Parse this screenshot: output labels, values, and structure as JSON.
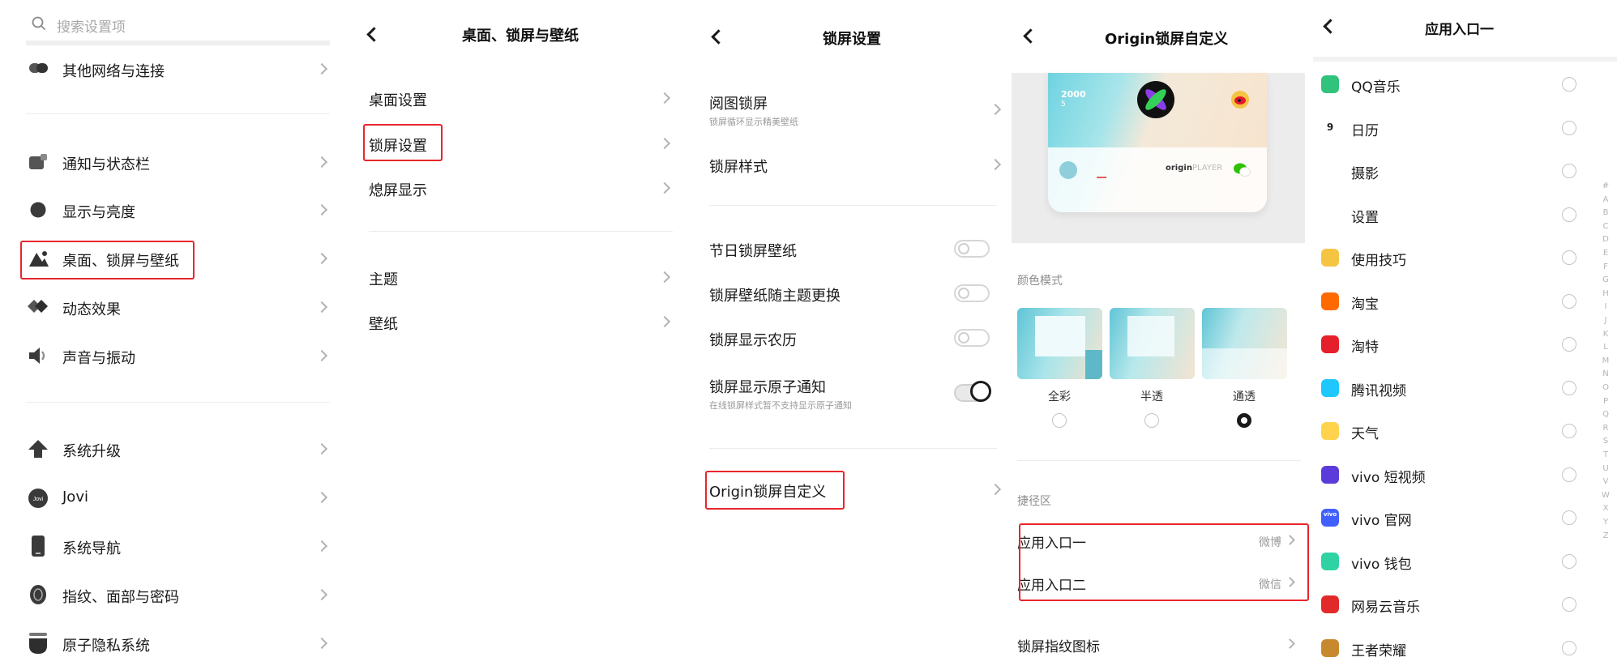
{
  "panel1": {
    "search_placeholder": "搜索设置项",
    "items": [
      {
        "label": "其他网络与连接",
        "icon": "link-icon"
      },
      {
        "label": "通知与状态栏",
        "icon": "notification-icon"
      },
      {
        "label": "显示与亮度",
        "icon": "brightness-icon"
      },
      {
        "label": "桌面、锁屏与壁纸",
        "icon": "wallpaper-icon",
        "highlighted": true
      },
      {
        "label": "动态效果",
        "icon": "animation-icon"
      },
      {
        "label": "声音与振动",
        "icon": "sound-icon"
      },
      {
        "label": "系统升级",
        "icon": "upgrade-icon"
      },
      {
        "label": "Jovi",
        "icon": "jovi-icon"
      },
      {
        "label": "系统导航",
        "icon": "phone-icon"
      },
      {
        "label": "指纹、面部与密码",
        "icon": "fingerprint-icon"
      },
      {
        "label": "原子隐私系统",
        "icon": "privacy-icon"
      }
    ]
  },
  "panel2": {
    "title": "桌面、锁屏与壁纸",
    "items": [
      {
        "label": "桌面设置"
      },
      {
        "label": "锁屏设置",
        "highlighted": true
      },
      {
        "label": "熄屏显示"
      },
      {
        "label": "主题"
      },
      {
        "label": "壁纸"
      }
    ]
  },
  "panel3": {
    "title": "锁屏设置",
    "items": [
      {
        "label": "阅图锁屏",
        "sub": "锁屏循环显示精美壁纸"
      },
      {
        "label": "锁屏样式"
      },
      {
        "label": "节日锁屏壁纸",
        "toggle": false
      },
      {
        "label": "锁屏壁纸随主题更换",
        "toggle": false
      },
      {
        "label": "锁屏显示农历",
        "toggle": false
      },
      {
        "label": "锁屏显示原子通知",
        "sub": "在线锁屏样式暂不支持显示原子通知",
        "toggle": true
      },
      {
        "label": "Origin锁屏自定义",
        "highlighted": true
      }
    ]
  },
  "panel4": {
    "title": "Origin锁屏自定义",
    "preview": {
      "number": "2000",
      "sub_number": "5",
      "brand": "origin",
      "brand_suffix": "PLAYER"
    },
    "color_mode_label": "颜色模式",
    "color_modes": [
      {
        "label": "全彩",
        "selected": false
      },
      {
        "label": "半透",
        "selected": false
      },
      {
        "label": "通透",
        "selected": true
      }
    ],
    "shortcut_label": "捷径区",
    "entries": [
      {
        "label": "应用入口一",
        "value": "微博"
      },
      {
        "label": "应用入口二",
        "value": "微信"
      }
    ],
    "fingerprint_label": "锁屏指纹图标"
  },
  "panel5": {
    "title": "应用入口一",
    "apps": [
      {
        "label": "QQ音乐",
        "icon": "qq-music-icon",
        "color": "#31c27c"
      },
      {
        "label": "日历",
        "icon": "calendar-icon",
        "color": "#ffffff",
        "icon_text": "9"
      },
      {
        "label": "摄影",
        "icon": "camera-icon",
        "color": "#ffffff"
      },
      {
        "label": "设置",
        "icon": "settings-icon",
        "color": "#ffffff"
      },
      {
        "label": "使用技巧",
        "icon": "tips-icon",
        "color": "#f6c443"
      },
      {
        "label": "淘宝",
        "icon": "taobao-icon",
        "color": "#ff6a00"
      },
      {
        "label": "淘特",
        "icon": "taote-icon",
        "color": "#e5202b"
      },
      {
        "label": "腾讯视频",
        "icon": "tencent-video-icon",
        "color": "#1ec8ff"
      },
      {
        "label": "天气",
        "icon": "weather-icon",
        "color": "#ffd34d"
      },
      {
        "label": "vivo 短视频",
        "icon": "vivo-short-video-icon",
        "color": "#5b3bd9"
      },
      {
        "label": "vivo 官网",
        "icon": "vivo-official-icon",
        "color": "#415fff",
        "icon_text": "vivo"
      },
      {
        "label": "vivo 钱包",
        "icon": "vivo-wallet-icon",
        "color": "#2fd3a3"
      },
      {
        "label": "网易云音乐",
        "icon": "netease-music-icon",
        "color": "#e22a2a"
      },
      {
        "label": "王者荣耀",
        "icon": "honor-of-kings-icon",
        "color": "#c8892e"
      }
    ],
    "index_letters": [
      "#",
      "A",
      "B",
      "C",
      "D",
      "E",
      "F",
      "G",
      "H",
      "I",
      "J",
      "K",
      "L",
      "M",
      "N",
      "O",
      "P",
      "Q",
      "R",
      "S",
      "T",
      "U",
      "V",
      "W",
      "X",
      "Y",
      "Z"
    ]
  }
}
